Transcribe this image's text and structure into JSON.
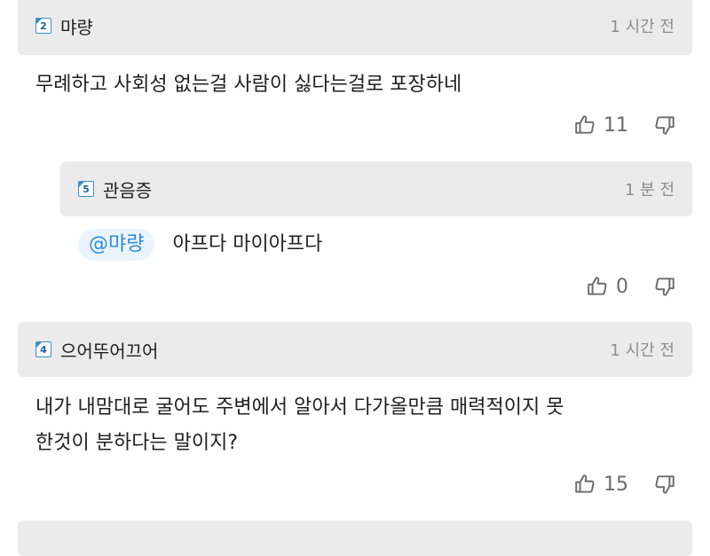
{
  "comments": [
    {
      "user": "먀량",
      "level_badge": "2",
      "time": "1 시간 전",
      "text": "무례하고 사회성 없는걸 사람이 싫다는걸로 포장하네",
      "likes": "11"
    },
    {
      "user": "관음증",
      "level_badge": "5",
      "time": "1 분 전",
      "mention": "@먀량",
      "text": "아프다 마이아프다",
      "likes": "0"
    },
    {
      "user": "으어뚜어끄어",
      "level_badge": "4",
      "time": "1 시간 전",
      "text_line1": "내가 내맘대로 굴어도 주변에서 알아서 다가올만큼 매력적이지 못",
      "text_line2": "한것이 분하다는 말이지?",
      "likes": "15"
    }
  ],
  "icons": {
    "like": "thumbs-up-icon",
    "dislike": "thumbs-down-icon"
  },
  "colors": {
    "header_bg": "#ebebeb",
    "mention_text": "#2f8be0",
    "mention_bg": "#eaf4fc",
    "badge": "#3a8fc9"
  }
}
